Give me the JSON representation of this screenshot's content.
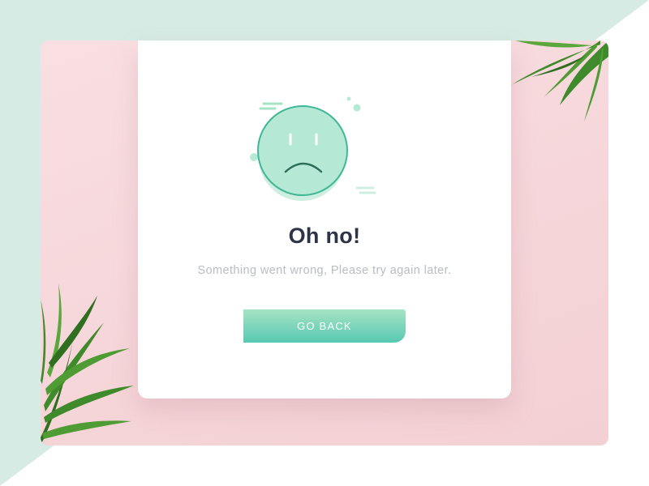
{
  "error_card": {
    "title": "Oh no!",
    "message": "Something went wrong, Please try again later.",
    "button_label": "GO BACK",
    "icon": "sad-face-icon"
  },
  "colors": {
    "accent_mint": "#57c9b2",
    "accent_mint_light": "#a6e3c4",
    "title_text": "#2d3447",
    "message_text": "#b9bcc4",
    "background_mint": "#d5ebe4",
    "background_pink": "#f6d6da",
    "leaf_green": "#3f8a2a"
  }
}
